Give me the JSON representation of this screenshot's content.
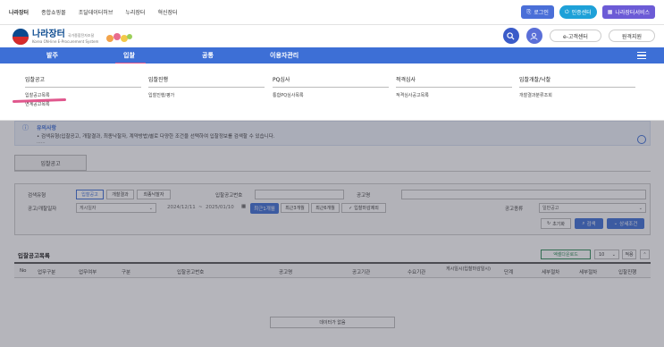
{
  "topnav": [
    "나라장터",
    "종합쇼핑몰",
    "조달데이터허브",
    "누리장터",
    "혁신장터"
  ],
  "topbtns": {
    "login": "로그인",
    "cert": "인증센터",
    "services": "나라장터서비스"
  },
  "logo": {
    "name": "나라장터",
    "sub": "Korea ON-line E-Procurement System",
    "tagline": "국가종합전자조달"
  },
  "header": {
    "customer_center": "e-고객센터",
    "remote_support": "원격지원"
  },
  "mainnav": [
    "발주",
    "입찰",
    "공통",
    "이용자관리"
  ],
  "mega": [
    {
      "title": "입찰공고",
      "items": [
        "입찰공고목록",
        "연계공고목록"
      ]
    },
    {
      "title": "입찰진행",
      "items": [
        "입찰진행/평가"
      ]
    },
    {
      "title": "PQ심사",
      "items": [
        "통합PQ심사목록"
      ]
    },
    {
      "title": "적격심사",
      "items": [
        "적격심사공고목록"
      ]
    },
    {
      "title": "입찰개찰/낙찰",
      "items": [
        "개찰결과분류조회"
      ]
    }
  ],
  "notice": {
    "title": "유의사항",
    "text": "• 검색유형(입찰공고, 개찰결과, 최종낙찰자, 계약방법)별로 다양한 조건을 선택하여 입찰정보를 검색할 수 있습니다.",
    "more": "......"
  },
  "tab": "입찰공고",
  "search": {
    "type_label": "검색유형",
    "types": [
      "입찰공고",
      "개찰결과",
      "최종낙찰자"
    ],
    "notice_no_label": "입찰공고번호",
    "notice_name_label": "공고명",
    "date_label": "공고/개찰일자",
    "date_type": "게시일자",
    "date_from": "2024/12/11",
    "date_sep": "~",
    "date_to": "2025/01/10",
    "period_btns": [
      "최근1개월",
      "최근3개월",
      "최근6개월"
    ],
    "check_label": "입찰마감제외",
    "kind_label": "공고종류",
    "kind_value": "일반공고",
    "reset": "초기화",
    "search": "검색",
    "detail": "상세조건"
  },
  "list": {
    "title": "입찰공고목록",
    "excel": "엑셀다운로드",
    "page_size": "10",
    "apply": "적용",
    "columns": [
      "No",
      "업무구분",
      "업무여부",
      "구분",
      "입찰공고번호",
      "공고명",
      "공고기관",
      "수요기관",
      "게시일시(입찰마감일시)",
      "단계",
      "세부절차",
      "세부절차",
      "입찰진행"
    ],
    "empty": "데이터가 없음"
  },
  "colors": {
    "primary": "#3d6fd6",
    "accent": "#e0578d"
  }
}
